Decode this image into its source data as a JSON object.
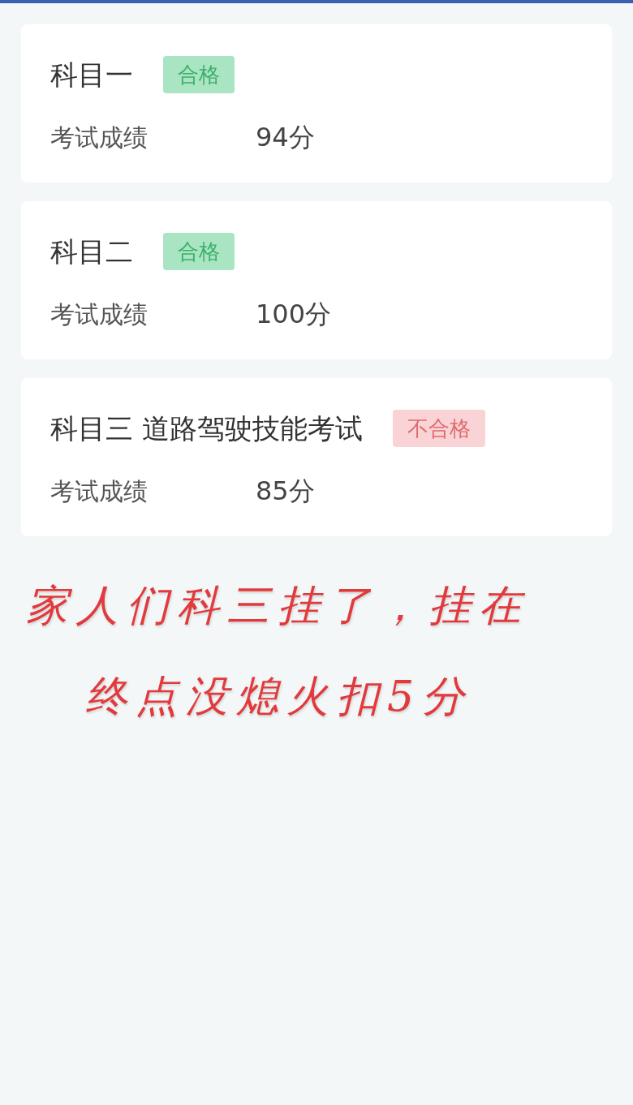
{
  "subjects": [
    {
      "title": "科目一",
      "result": "合格",
      "passed": true,
      "score_label": "考试成绩",
      "score": "94分"
    },
    {
      "title": "科目二",
      "result": "合格",
      "passed": true,
      "score_label": "考试成绩",
      "score": "100分"
    },
    {
      "title": "科目三 道路驾驶技能考试",
      "result": "不合格",
      "passed": false,
      "score_label": "考试成绩",
      "score": "85分"
    }
  ],
  "handwritten_note": {
    "lines": [
      "家人们科三挂了，挂在",
      "终点没熄火扣5分"
    ]
  }
}
